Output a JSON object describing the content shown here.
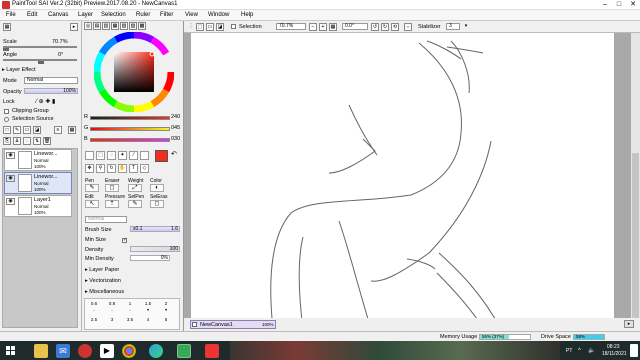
{
  "window": {
    "title": "PaintTool SAI Ver.2 (32bit) Preview.2017.08.20 - NewCanvas1"
  },
  "menu": [
    "File",
    "Edit",
    "Canvas",
    "Layer",
    "Selection",
    "Ruler",
    "Filter",
    "View",
    "Window",
    "Help"
  ],
  "left_panel": {
    "scale_label": "Scale",
    "scale_value": "70.7%",
    "angle_label": "Angle",
    "angle_value": "0°",
    "layer_effect": "Layer Effect",
    "mode_label": "Mode",
    "mode_value": "Normal",
    "opacity_label": "Opacity",
    "opacity_value": "100%",
    "lock_label": "Lock",
    "clipping_group": "Clipping Group",
    "selection_source": "Selection Source",
    "layers": [
      {
        "name": "Linewor...",
        "mode": "Normal",
        "opacity": "100%",
        "selected": false
      },
      {
        "name": "Linewor...",
        "mode": "Normal",
        "opacity": "100%",
        "selected": true
      },
      {
        "name": "Layer1",
        "mode": "Normal",
        "opacity": "100%",
        "selected": false
      }
    ]
  },
  "color_panel": {
    "r_label": "R",
    "r_value": "240",
    "g_label": "G",
    "g_value": "045",
    "b_label": "B",
    "b_value": "030",
    "current_color": "#f02d1e"
  },
  "tools": {
    "headers": [
      "Pen",
      "Eraser",
      "Weight",
      "Color",
      "Edit",
      "Pressure",
      "SelPen",
      "SelEras"
    ],
    "brush_size_label": "Brush Size",
    "brush_size_mult": "x0.1",
    "brush_size_value": "1.6",
    "min_size_label": "Min Size",
    "density_label": "Density",
    "density_value": "100",
    "min_density_label": "Min Density",
    "min_density_value": "0%",
    "layer_paper": "Layer Paper",
    "vectorization": "Vectorization",
    "miscellaneous": "Miscellaneous",
    "size_row1": [
      "0.6",
      "0.8",
      "1",
      "1.5",
      "2"
    ],
    "size_row2": [
      "2.5",
      "3",
      "3.5",
      "4",
      "5"
    ],
    "normal_label": "Normal"
  },
  "toolbar": {
    "selection_label": "Selection",
    "zoom_value": "70.7%",
    "angle_value": "0.0°",
    "stabilizer_label": "Stabilizer",
    "stabilizer_value": "3"
  },
  "canvas_tab": {
    "name": "NewCanvas1",
    "zoom": "100%"
  },
  "status": {
    "memory_label": "Memory Usage",
    "memory_value": "56% (37%)",
    "drive_label": "Drive Space",
    "drive_value": "58%"
  },
  "taskbar": {
    "time": "08:23",
    "date": "18/11/2021",
    "lang": "PT"
  }
}
